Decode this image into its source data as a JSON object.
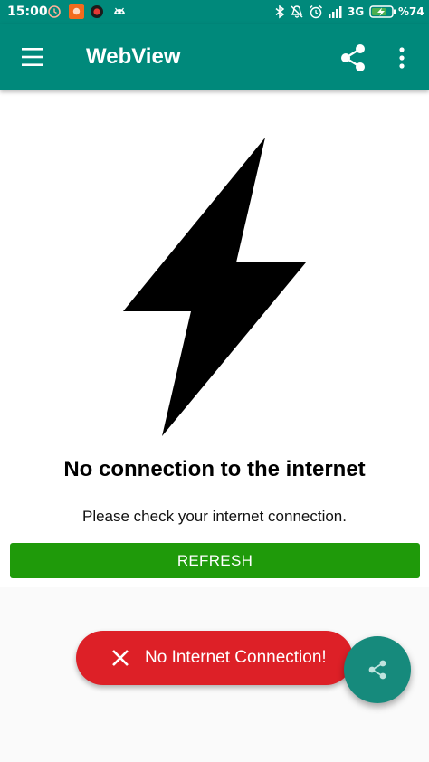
{
  "status_bar": {
    "time": "15:00",
    "network": "3G",
    "battery": "%74"
  },
  "app_bar": {
    "title": "WebView",
    "color": "#00897b",
    "icons": [
      "menu-icon",
      "share-icon",
      "more-vert-icon"
    ]
  },
  "main": {
    "icon": "lightning-bolt-icon",
    "heading": "No connection to the internet",
    "subtext": "Please check your internet connection.",
    "refresh_label": "REFRESH",
    "refresh_color": "#1f9a0a"
  },
  "snackbar": {
    "message": "No Internet Connection!",
    "icon": "close-icon",
    "color": "#dd2027"
  },
  "fab": {
    "icon": "share-icon",
    "color": "#168a7c"
  }
}
